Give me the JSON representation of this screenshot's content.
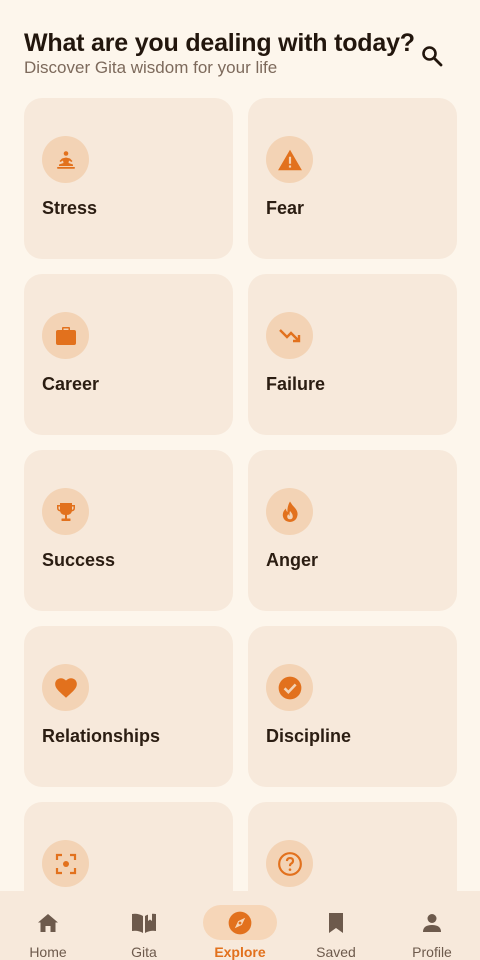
{
  "header": {
    "title": "What are you dealing with today?",
    "subtitle": "Discover Gita wisdom for your life"
  },
  "colors": {
    "accent": "#e2711d",
    "background": "#fdf6ec",
    "card": "#f7e9db",
    "icon_circle": "#f3d3b5"
  },
  "topics": [
    {
      "label": "Stress",
      "icon": "meditation-icon"
    },
    {
      "label": "Fear",
      "icon": "warning-icon"
    },
    {
      "label": "Career",
      "icon": "briefcase-icon"
    },
    {
      "label": "Failure",
      "icon": "trending-down-icon"
    },
    {
      "label": "Success",
      "icon": "trophy-icon"
    },
    {
      "label": "Anger",
      "icon": "fire-icon"
    },
    {
      "label": "Relationships",
      "icon": "heart-icon"
    },
    {
      "label": "Discipline",
      "icon": "check-circle-icon"
    },
    {
      "label": "",
      "icon": "focus-icon"
    },
    {
      "label": "",
      "icon": "help-circle-icon"
    }
  ],
  "nav": {
    "items": [
      {
        "label": "Home",
        "icon": "home-icon"
      },
      {
        "label": "Gita",
        "icon": "book-icon"
      },
      {
        "label": "Explore",
        "icon": "compass-icon",
        "active": true
      },
      {
        "label": "Saved",
        "icon": "bookmark-icon"
      },
      {
        "label": "Profile",
        "icon": "person-icon"
      }
    ]
  }
}
